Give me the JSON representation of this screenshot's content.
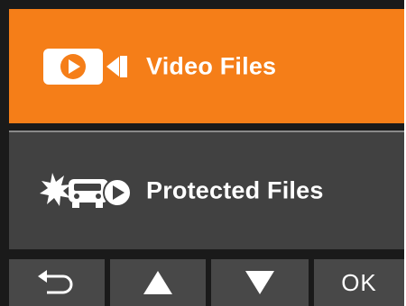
{
  "menu": {
    "items": [
      {
        "label": "Video Files",
        "icon": "video-camera-icon",
        "selected": true
      },
      {
        "label": "Protected Files",
        "icon": "protected-collision-video-icon",
        "selected": false
      }
    ]
  },
  "bottom_bar": {
    "back_icon": "back-arrow-icon",
    "up_icon": "up-triangle-icon",
    "down_icon": "down-triangle-icon",
    "ok_label": "OK"
  },
  "colors": {
    "selected_background": "#f57e18",
    "item_background": "#414141",
    "bar_button_background": "#484848",
    "screen_background": "#1a1a1a",
    "text": "#ffffff"
  }
}
